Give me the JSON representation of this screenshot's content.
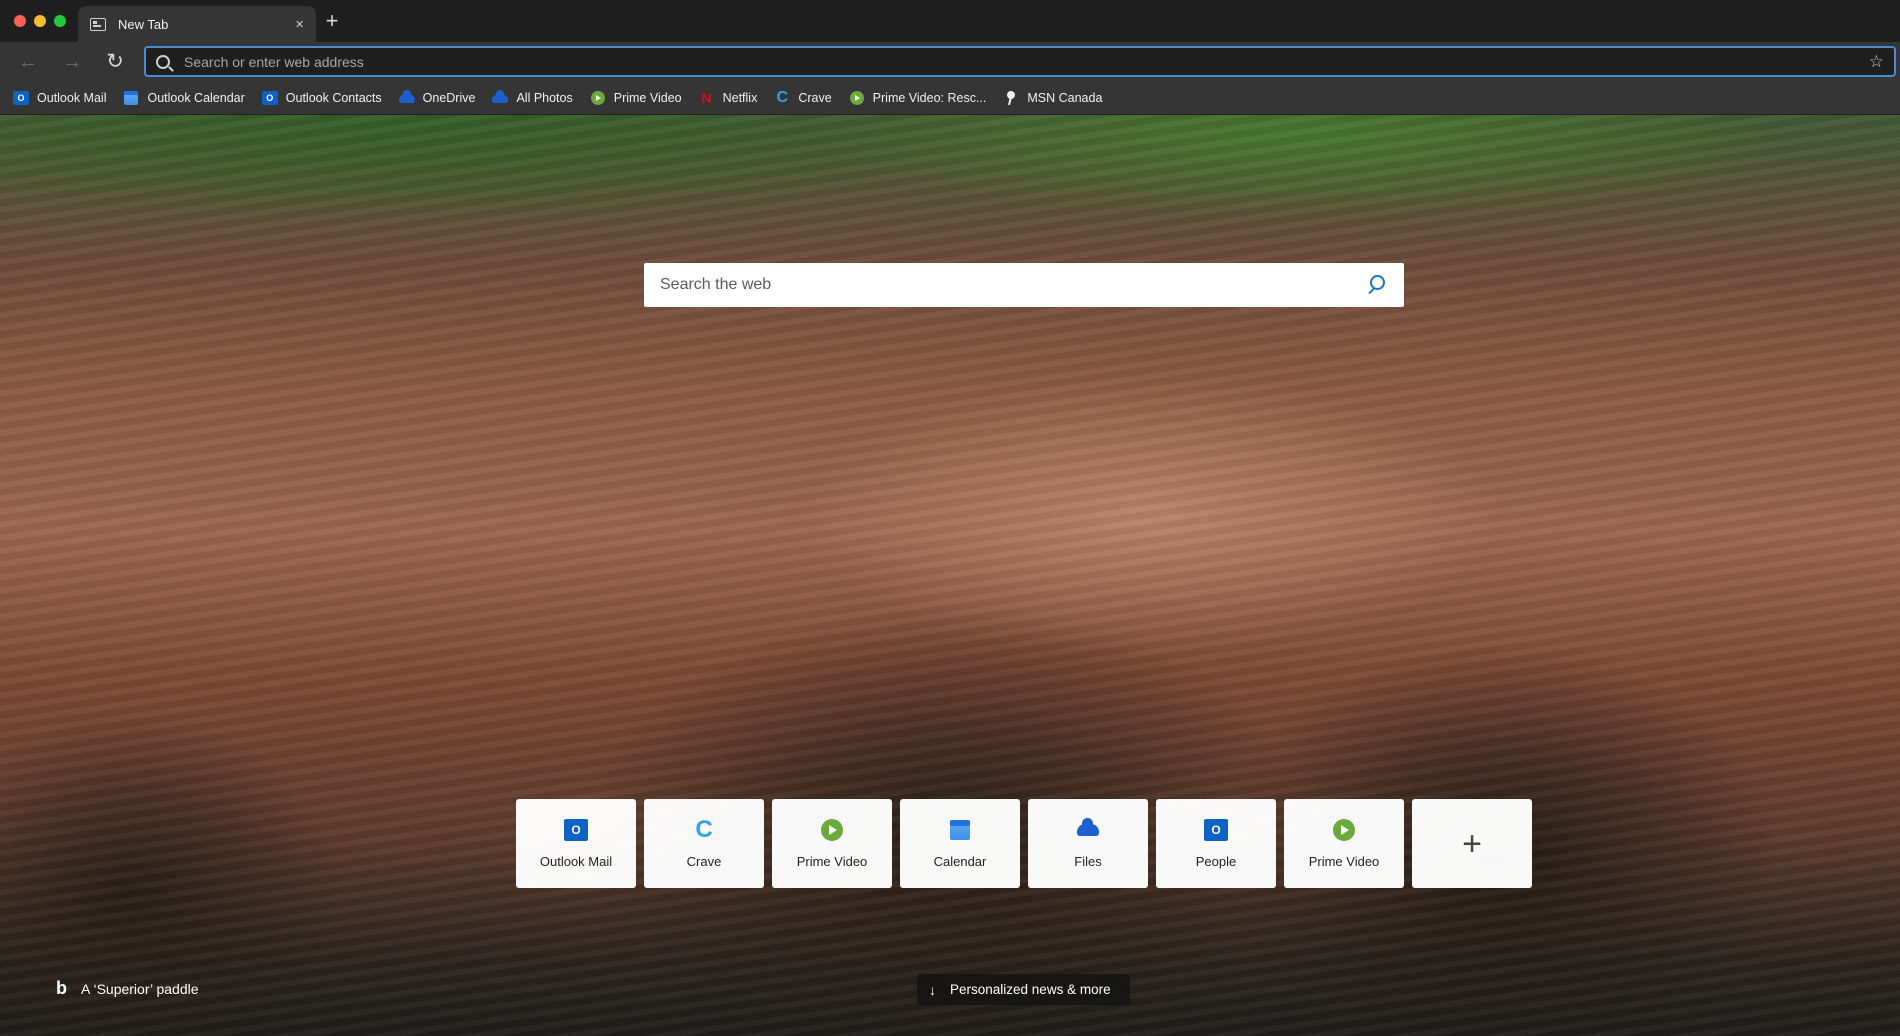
{
  "tab": {
    "title": "New Tab",
    "close": "×",
    "new_tab": "+"
  },
  "toolbar": {
    "back": "←",
    "forward": "→",
    "reload": "↻",
    "address_placeholder": "Search or enter web address",
    "star": "☆"
  },
  "bookmarks": [
    {
      "label": "Outlook Mail",
      "icon": "outlook-icon"
    },
    {
      "label": "Outlook Calendar",
      "icon": "calendar-icon"
    },
    {
      "label": "Outlook Contacts",
      "icon": "outlook-icon"
    },
    {
      "label": "OneDrive",
      "icon": "cloud-icon"
    },
    {
      "label": "All Photos",
      "icon": "cloud-icon"
    },
    {
      "label": "Prime Video",
      "icon": "play-icon"
    },
    {
      "label": "Netflix",
      "icon": "netflix-icon"
    },
    {
      "label": "Crave",
      "icon": "crave-icon"
    },
    {
      "label": "Prime Video: Resc...",
      "icon": "play-icon"
    },
    {
      "label": "MSN Canada",
      "icon": "msn-icon"
    }
  ],
  "ntp": {
    "search_placeholder": "Search the web",
    "tiles": [
      {
        "label": "Outlook Mail",
        "icon": "outlook-icon"
      },
      {
        "label": "Crave",
        "icon": "crave-icon"
      },
      {
        "label": "Prime Video",
        "icon": "play-icon"
      },
      {
        "label": "Calendar",
        "icon": "calendar-icon"
      },
      {
        "label": "Files",
        "icon": "cloud-icon"
      },
      {
        "label": "People",
        "icon": "outlook-icon"
      },
      {
        "label": "Prime Video",
        "icon": "play-icon"
      }
    ],
    "add_tile": "+",
    "image_credit": "A ‘Superior’ paddle",
    "bing_logo": "b",
    "news_arrow": "↓",
    "news_button": "Personalized news & more"
  },
  "glyphs": {
    "outlook_letter": "O",
    "netflix_letter": "N",
    "crave_letter": "C"
  },
  "colors": {
    "accent": "#4c8ad9",
    "search_icon": "#1a73c9",
    "netflix": "#e50914",
    "prime": "#6ca83a",
    "outlook": "#0f62c5"
  }
}
